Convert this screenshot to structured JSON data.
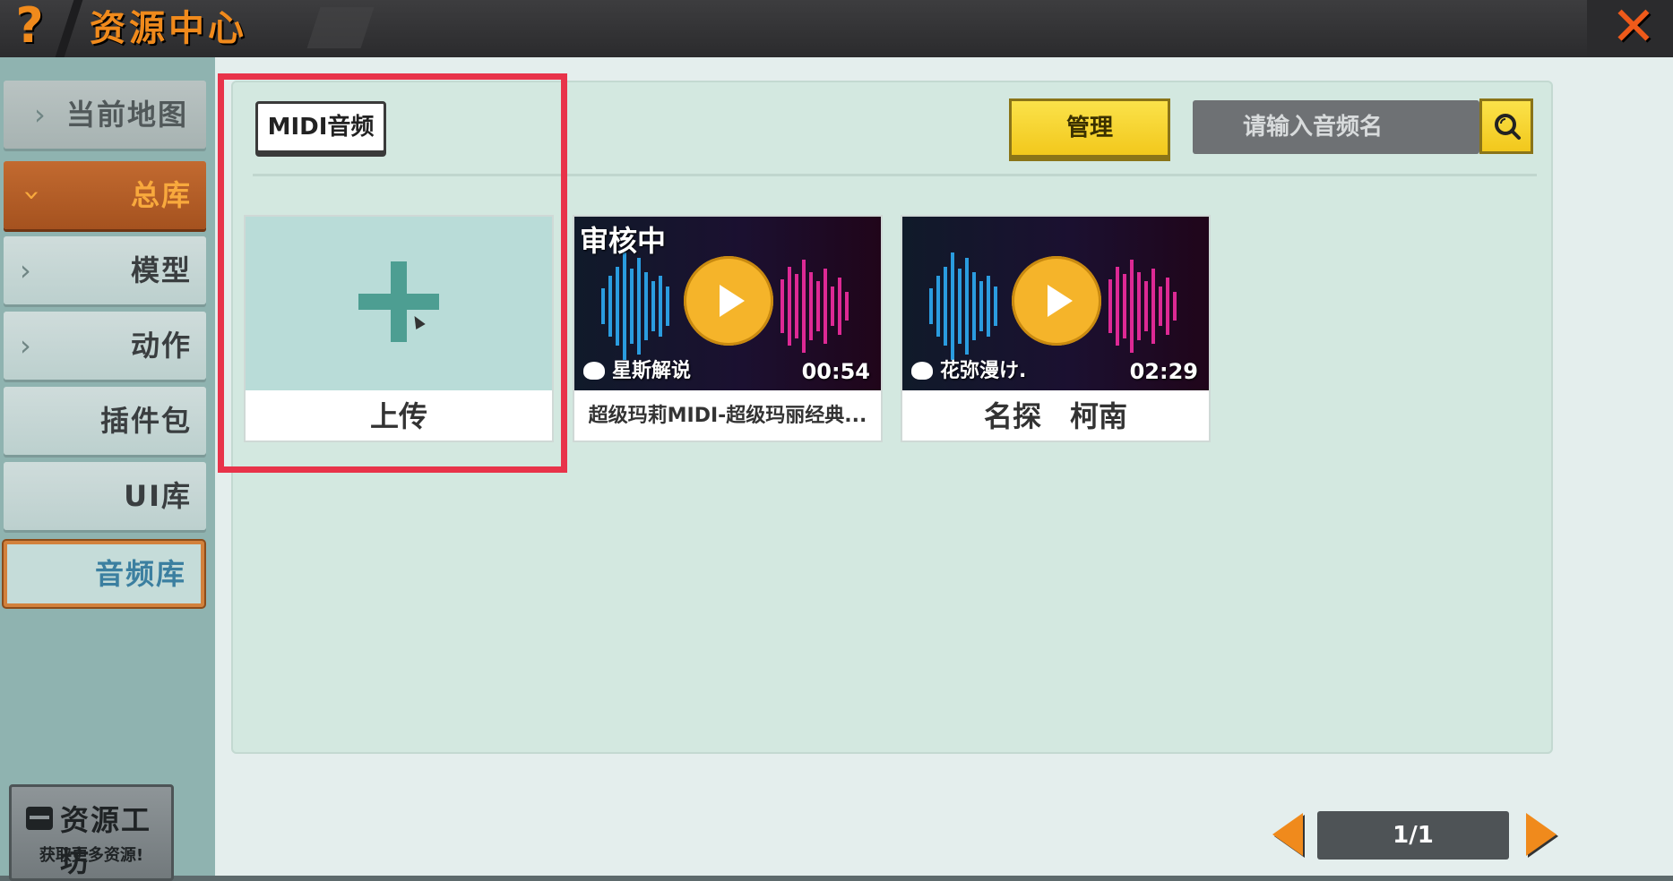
{
  "titlebar": {
    "title": "资源中心",
    "help_icon": "question-mark-icon",
    "close_icon": "close-x-icon",
    "help_glyph": "?",
    "close_glyph": "✕"
  },
  "sidebar": {
    "items": [
      {
        "label": "当前地图",
        "state": "normal"
      },
      {
        "label": "总库",
        "state": "expanded"
      },
      {
        "label": "模型",
        "state": "normal"
      },
      {
        "label": "动作",
        "state": "normal"
      },
      {
        "label": "插件包",
        "state": "normal"
      },
      {
        "label": "UI库",
        "state": "normal"
      },
      {
        "label": "音频库",
        "state": "selected"
      }
    ],
    "workshop": {
      "title": "资源工坊",
      "subtitle": "获取更多资源!"
    }
  },
  "toolbar": {
    "tab_label": "MIDI音频",
    "manage_label": "管理",
    "search_placeholder": "请输入音频名"
  },
  "cards": [
    {
      "caption": "上传",
      "type": "upload"
    },
    {
      "caption": "超级玛莉MIDI-超级玛丽经典...",
      "status": "审核中",
      "author": "星斯解说",
      "duration": "00:54",
      "type": "audio"
    },
    {
      "caption": "名探　柯南",
      "status": "",
      "author": "花弥漫け.",
      "duration": "02:29",
      "type": "audio"
    }
  ],
  "pagination": {
    "page": "1/1"
  },
  "colors": {
    "accent_orange": "#f08a1c",
    "manage_yellow": "#f2c81c",
    "highlight_red": "#e8334a"
  }
}
